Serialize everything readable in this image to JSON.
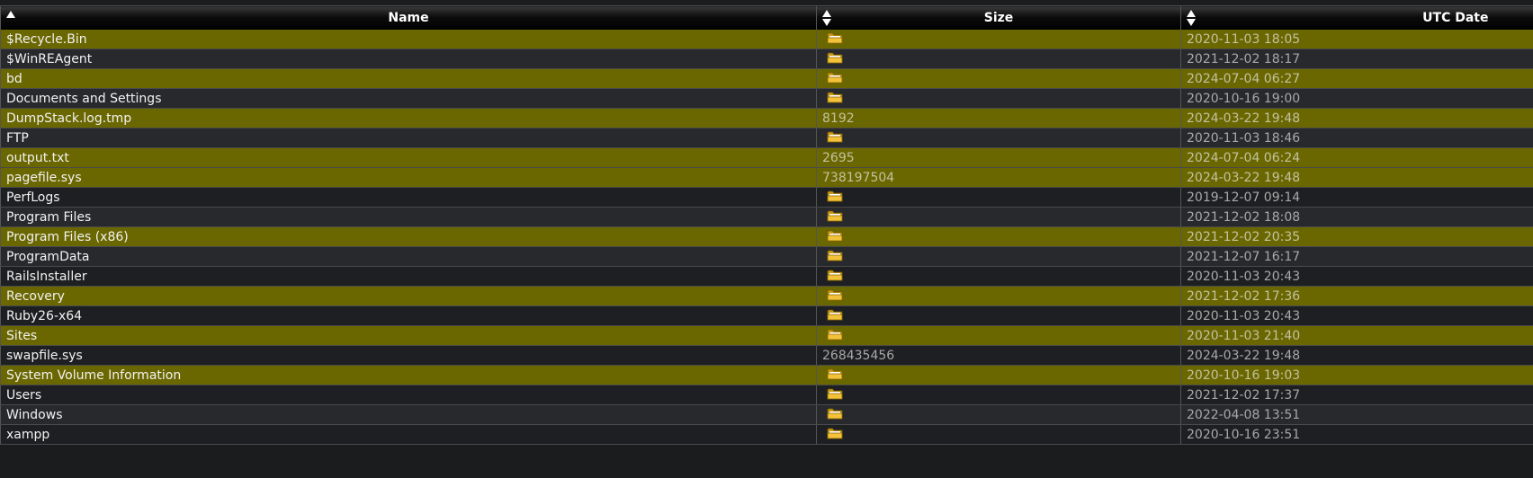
{
  "columns": {
    "name": "Name",
    "size": "Size",
    "date": "UTC Date"
  },
  "rows": [
    {
      "name": "$Recycle.Bin",
      "size": "",
      "folder": true,
      "date": "2020-11-03 18:05",
      "highlight": true
    },
    {
      "name": "$WinREAgent",
      "size": "",
      "folder": true,
      "date": "2021-12-02 18:17",
      "highlight": false
    },
    {
      "name": "bd",
      "size": "",
      "folder": true,
      "date": "2024-07-04 06:27",
      "highlight": true
    },
    {
      "name": "Documents and Settings",
      "size": "",
      "folder": true,
      "date": "2020-10-16 19:00",
      "highlight": false
    },
    {
      "name": "DumpStack.log.tmp",
      "size": "8192",
      "folder": false,
      "date": "2024-03-22 19:48",
      "highlight": true
    },
    {
      "name": "FTP",
      "size": "",
      "folder": true,
      "date": "2020-11-03 18:46",
      "highlight": false
    },
    {
      "name": "output.txt",
      "size": "2695",
      "folder": false,
      "date": "2024-07-04 06:24",
      "highlight": true
    },
    {
      "name": "pagefile.sys",
      "size": "738197504",
      "folder": false,
      "date": "2024-03-22 19:48",
      "highlight": true
    },
    {
      "name": "PerfLogs",
      "size": "",
      "folder": true,
      "date": "2019-12-07 09:14",
      "highlight": false
    },
    {
      "name": "Program Files",
      "size": "",
      "folder": true,
      "date": "2021-12-02 18:08",
      "highlight": false
    },
    {
      "name": "Program Files (x86)",
      "size": "",
      "folder": true,
      "date": "2021-12-02 20:35",
      "highlight": true
    },
    {
      "name": "ProgramData",
      "size": "",
      "folder": true,
      "date": "2021-12-07 16:17",
      "highlight": false
    },
    {
      "name": "RailsInstaller",
      "size": "",
      "folder": true,
      "date": "2020-11-03 20:43",
      "highlight": false
    },
    {
      "name": "Recovery",
      "size": "",
      "folder": true,
      "date": "2021-12-02 17:36",
      "highlight": true
    },
    {
      "name": "Ruby26-x64",
      "size": "",
      "folder": true,
      "date": "2020-11-03 20:43",
      "highlight": false
    },
    {
      "name": "Sites",
      "size": "",
      "folder": true,
      "date": "2020-11-03 21:40",
      "highlight": true
    },
    {
      "name": "swapfile.sys",
      "size": "268435456",
      "folder": false,
      "date": "2024-03-22 19:48",
      "highlight": false
    },
    {
      "name": "System Volume Information",
      "size": "",
      "folder": true,
      "date": "2020-10-16 19:03",
      "highlight": true
    },
    {
      "name": "Users",
      "size": "",
      "folder": true,
      "date": "2021-12-02 17:37",
      "highlight": false
    },
    {
      "name": "Windows",
      "size": "",
      "folder": true,
      "date": "2022-04-08 13:51",
      "highlight": false
    },
    {
      "name": "xampp",
      "size": "",
      "folder": true,
      "date": "2020-10-16 23:51",
      "highlight": false
    }
  ],
  "colors": {
    "highlight_row": "#6b6700",
    "dark_row": "#1d1f22",
    "header_bg": "#000000",
    "page_bg": "#1b1c1e"
  },
  "icons": {
    "folder": "folder-icon",
    "sort_ascending": "sort-ascending-icon",
    "sort_both": "sort-both-icon"
  }
}
